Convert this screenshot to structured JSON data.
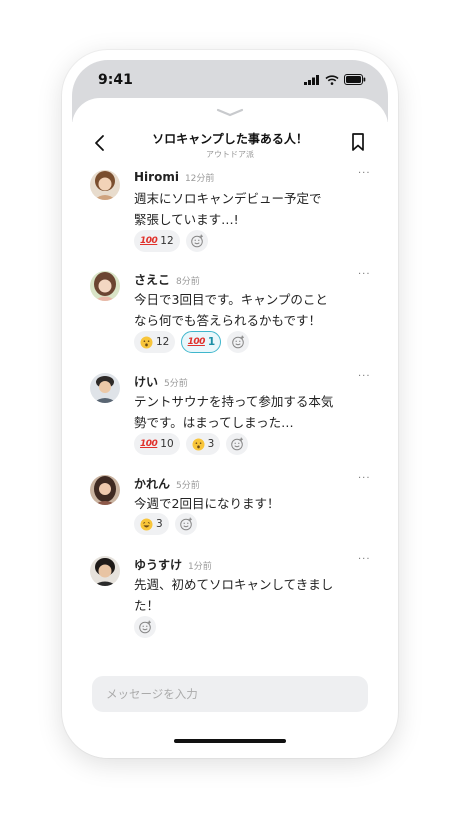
{
  "status_bar": {
    "time": "9:41"
  },
  "header": {
    "title": "ソロキャンプした事ある人！",
    "subtitle": "アウトドア派"
  },
  "messages": [
    {
      "name": "Hiromi",
      "ago": "12分前",
      "lines": [
        "週末にソロキャンデビュー予定で",
        "緊張しています…!"
      ],
      "reactions": [
        {
          "emoji": "100",
          "count": "12"
        }
      ]
    },
    {
      "name": "さえこ",
      "ago": "8分前",
      "lines": [
        "今日で3回目です。キャンプのこと",
        "なら何でも答えられるかもです！"
      ],
      "reactions": [
        {
          "emoji": "hushed",
          "count": "12"
        },
        {
          "emoji": "100",
          "count": "1",
          "active": true
        }
      ]
    },
    {
      "name": "けい",
      "ago": "5分前",
      "lines": [
        "テントサウナを持って参加する本気",
        "勢です。はまってしまった…"
      ],
      "reactions": [
        {
          "emoji": "100",
          "count": "10"
        },
        {
          "emoji": "hushed",
          "count": "3"
        }
      ]
    },
    {
      "name": "かれん",
      "ago": "5分前",
      "lines": [
        "今週で2回目になります！"
      ],
      "reactions": [
        {
          "emoji": "grin",
          "count": "3"
        }
      ]
    },
    {
      "name": "ゆうすけ",
      "ago": "1分前",
      "lines": [
        "先週、初めてソロキャンしてきまし",
        "た！"
      ],
      "reactions": []
    }
  ],
  "composer": {
    "placeholder": "メッセージを入力"
  },
  "icons": {
    "more": "ellipsis-icon",
    "add_reaction": "add-reaction-icon",
    "back": "chevron-left-icon",
    "bookmark": "bookmark-icon",
    "handle": "chevron-down-icon"
  },
  "colors": {
    "accent": "#3fb6cc",
    "status_bg": "#d9dadd"
  }
}
